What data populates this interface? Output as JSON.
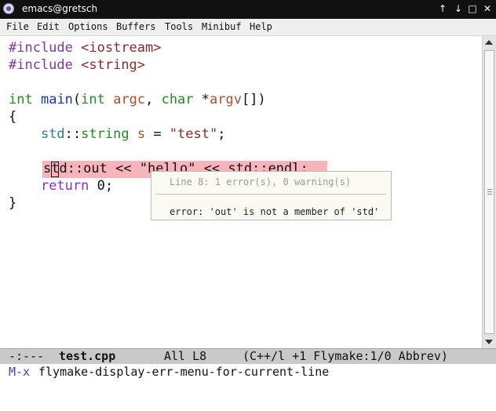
{
  "window": {
    "title": "emacs@gretsch"
  },
  "menubar": {
    "items": [
      "File",
      "Edit",
      "Options",
      "Buffers",
      "Tools",
      "Minibuf",
      "Help"
    ]
  },
  "code": {
    "line1": {
      "pp": "#include",
      "lib": "<iostream>"
    },
    "line2": {
      "pp": "#include",
      "lib": "<string>"
    },
    "line4": {
      "type1": "int",
      "fn": "main",
      "open": "(",
      "type2": "int",
      "arg1": "argc",
      "comma": ", ",
      "type3": "char",
      "star": " *",
      "arg2": "argv",
      "close": "[])"
    },
    "line5": "{",
    "line6": {
      "ns": "std",
      "sep": "::",
      "type": "string",
      "var": "s",
      "eq": " = ",
      "str": "\"test\"",
      "end": ";"
    },
    "line8": "std::out << \"hello\" << std::endl;",
    "line9": {
      "kw": "return",
      "rest": " 0;"
    },
    "line10": "}"
  },
  "tooltip": {
    "header": "Line 8: 1 error(s), 0 warning(s)",
    "message": "error: 'out' is not a member of 'std'"
  },
  "modeline": {
    "status": "-:---",
    "buffer": "test.cpp",
    "position": "All L8",
    "modes": "(C++/l +1 Flymake:1/0 Abbrev)"
  },
  "minibuffer": {
    "prompt": "M-x",
    "command": "flymake-display-err-menu-for-current-line"
  },
  "colors": {
    "error_highlight": "#f9b3bb",
    "keyword": "#8b2fc9",
    "string": "#8a2a2a",
    "type": "#228b22",
    "function": "#1a35b0"
  }
}
